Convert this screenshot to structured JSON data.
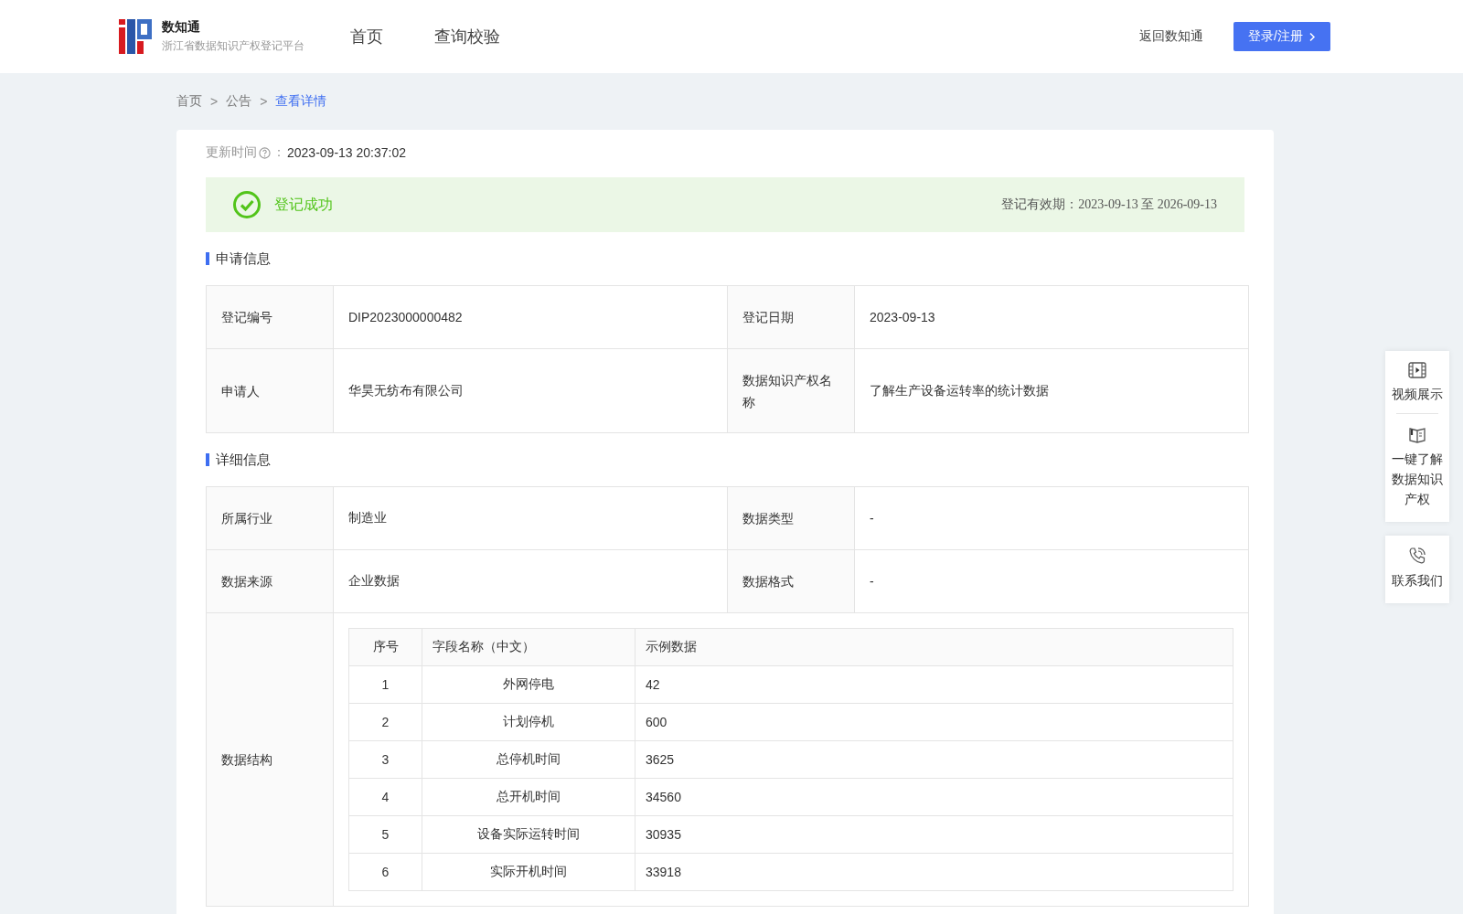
{
  "header": {
    "brand": "数知通",
    "subtitle": "浙江省数据知识产权登记平台",
    "nav": [
      {
        "label": "首页"
      },
      {
        "label": "查询校验"
      }
    ],
    "back_link": "返回数知通",
    "login_button": "登录/注册"
  },
  "breadcrumb_separator": ">",
  "breadcrumb": [
    {
      "label": "首页",
      "selected": false
    },
    {
      "label": "公告",
      "selected": false
    },
    {
      "label": "查看详情",
      "selected": true
    }
  ],
  "update": {
    "label": "更新时间",
    "colon": "：",
    "value": "2023-09-13 20:37:02"
  },
  "status": {
    "kind": "success",
    "label": "登记成功",
    "validity": "登记有效期：2023-09-13 至 2026-09-13"
  },
  "application": {
    "title": "申请信息",
    "rows": [
      {
        "cells": [
          {
            "label": "登记编号",
            "value": "DIP2023000000482"
          },
          {
            "label": "登记日期",
            "value": "2023-09-13"
          }
        ]
      },
      {
        "cells": [
          {
            "label": "申请人",
            "value": "华昊无纺布有限公司"
          },
          {
            "label": "数据知识产权名称",
            "value": "了解生产设备运转率的统计数据"
          }
        ]
      }
    ]
  },
  "details": {
    "title": "详细信息",
    "rows": [
      {
        "cells": [
          {
            "label": "所属行业",
            "value": "制造业"
          },
          {
            "label": "数据类型",
            "value": "-"
          }
        ]
      },
      {
        "cells": [
          {
            "label": "数据来源",
            "value": "企业数据"
          },
          {
            "label": "数据格式",
            "value": "-"
          }
        ]
      }
    ],
    "structure": {
      "label": "数据结构",
      "columns": [
        "序号",
        "字段名称（中文）",
        "示例数据"
      ],
      "rows": [
        [
          "1",
          "外网停电",
          "42"
        ],
        [
          "2",
          "计划停机",
          "600"
        ],
        [
          "3",
          "总停机时间",
          "3625"
        ],
        [
          "4",
          "总开机时间",
          "34560"
        ],
        [
          "5",
          "设备实际运转时间",
          "30935"
        ],
        [
          "6",
          "实际开机时间",
          "33918"
        ]
      ]
    }
  },
  "side_panel": [
    {
      "kind": "video",
      "label": "视频展示"
    },
    {
      "kind": "book",
      "label": "一键了解数据知识产权"
    },
    {
      "kind": "phone",
      "label": "联系我们"
    }
  ]
}
